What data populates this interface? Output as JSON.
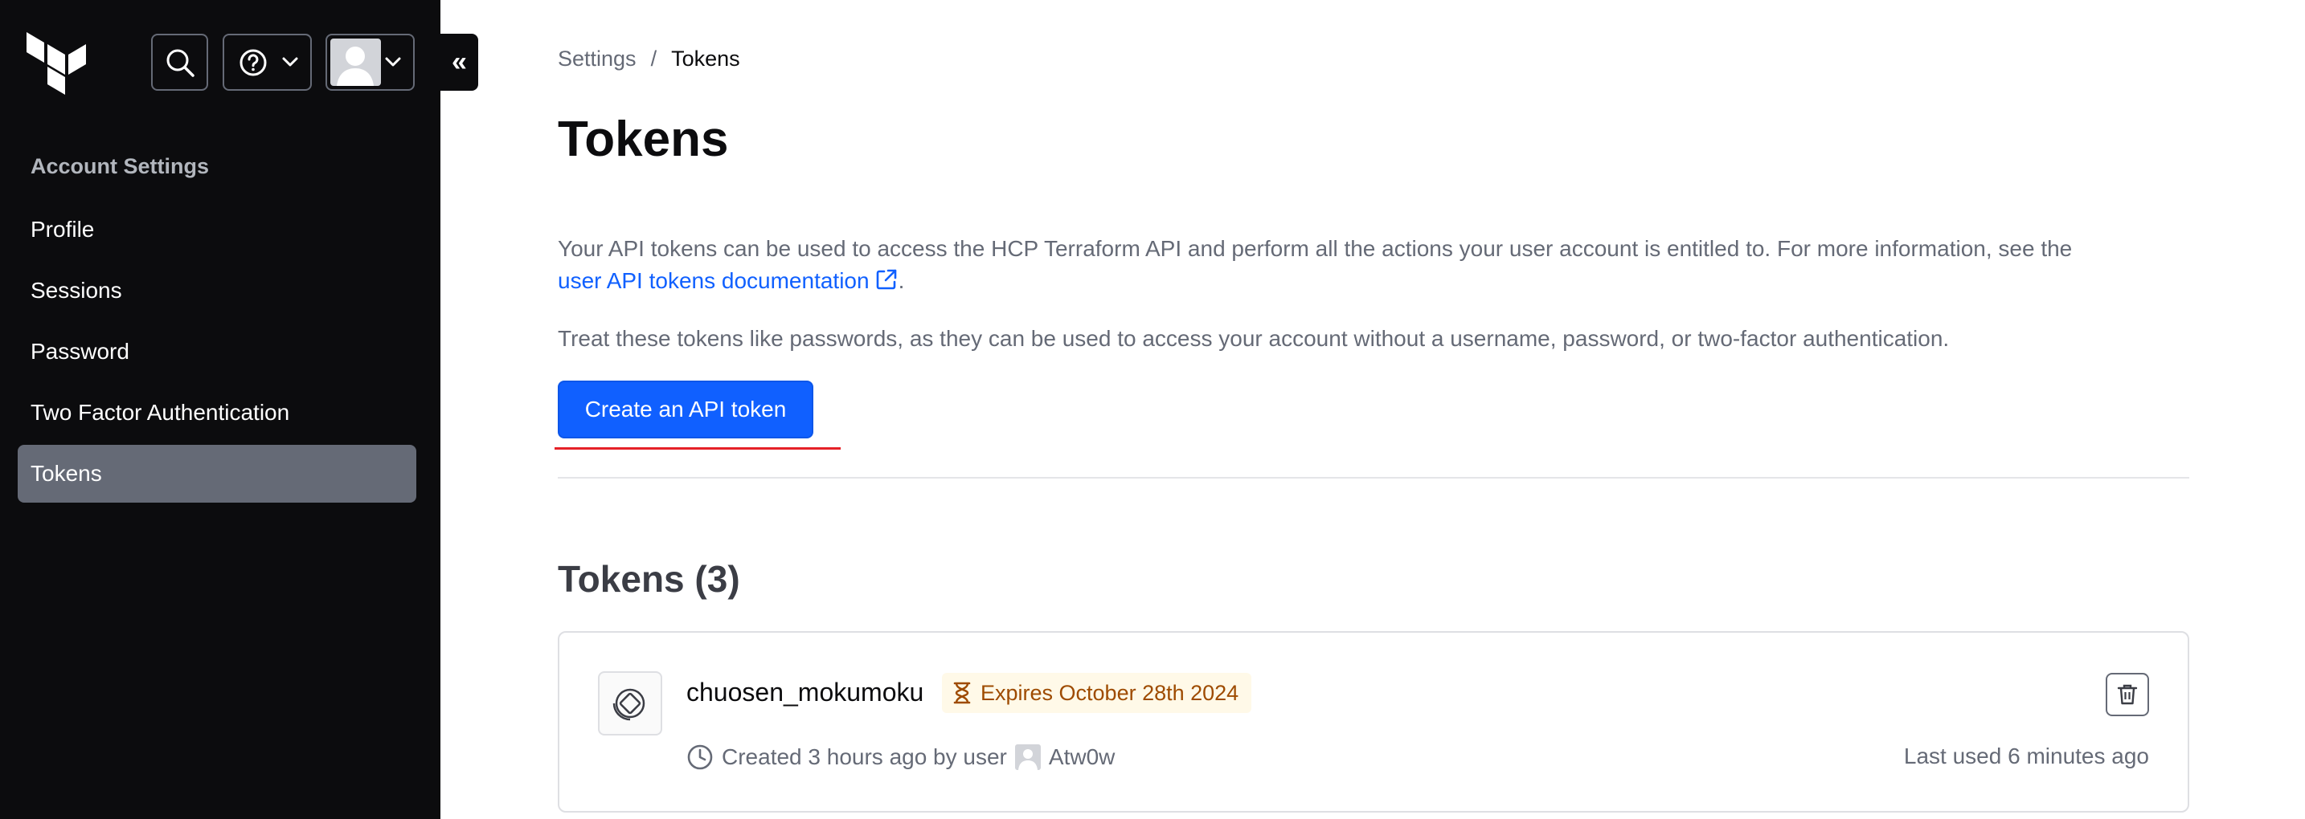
{
  "sidebar": {
    "heading": "Account Settings",
    "items": [
      {
        "label": "Profile"
      },
      {
        "label": "Sessions"
      },
      {
        "label": "Password"
      },
      {
        "label": "Two Factor Authentication"
      },
      {
        "label": "Tokens",
        "active": true
      }
    ],
    "collapse_label": "«"
  },
  "breadcrumb": {
    "parent": "Settings",
    "separator": "/",
    "current": "Tokens"
  },
  "page": {
    "title": "Tokens",
    "description_1": "Your API tokens can be used to access the HCP Terraform API and perform all the actions your user account is entitled to. For more information, see the",
    "doc_link": "user API tokens documentation",
    "description_1_end": ".",
    "description_2": "Treat these tokens like passwords, as they can be used to access your account without a username, password, or two-factor authentication.",
    "create_button": "Create an API token",
    "section_title": "Tokens (3)"
  },
  "tokens": [
    {
      "name": "chuosen_mokumoku",
      "expires": "Expires October 28th 2024",
      "created": "Created 3 hours ago by user",
      "user": "Atw0w",
      "last_used": "Last used 6 minutes ago"
    }
  ],
  "colors": {
    "sidebar_bg": "#0c0c0e",
    "active_item": "#656a76",
    "primary": "#1060ff",
    "warning_bg": "#fff9e8",
    "warning_text": "#9e4b00"
  },
  "icons": {
    "logo": "terraform-logo-icon",
    "search": "search-icon",
    "help": "help-icon",
    "chevron": "chevron-down-icon",
    "external": "external-link-icon",
    "token": "token-icon",
    "hourglass": "hourglass-icon",
    "trash": "trash-icon",
    "clock": "clock-icon"
  }
}
